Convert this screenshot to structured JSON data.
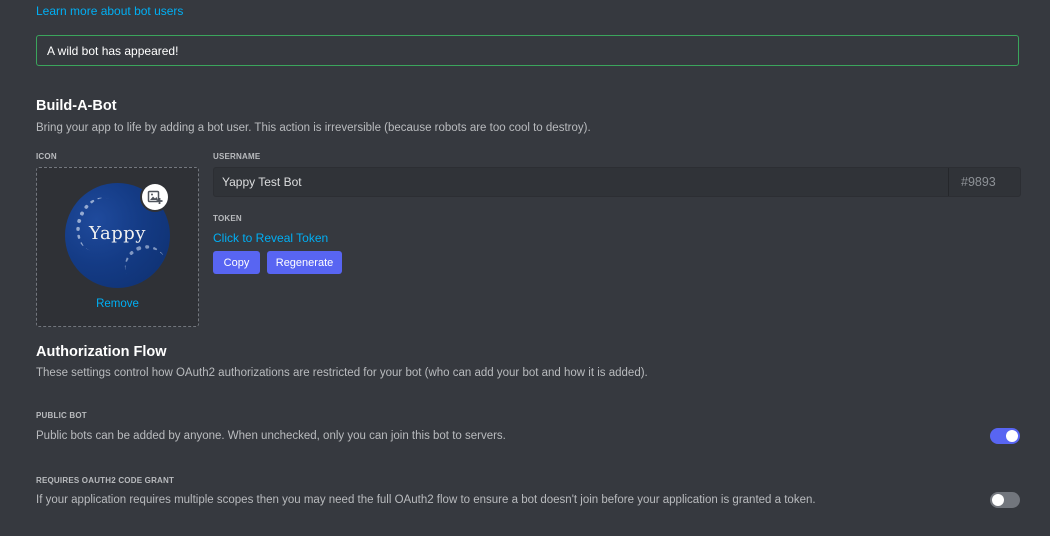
{
  "learn_more_link": "Learn more about bot users",
  "alert": {
    "text": "A wild bot has appeared!"
  },
  "build_a_bot": {
    "title": "Build-A-Bot",
    "description": "Bring your app to life by adding a bot user. This action is irreversible (because robots are too cool to destroy).",
    "icon_label": "ICON",
    "avatar_text": "Yappy",
    "remove_label": "Remove",
    "username_label": "USERNAME",
    "username_value": "Yappy Test Bot",
    "discriminator": "#9893",
    "token_label": "TOKEN",
    "reveal_token": "Click to Reveal Token",
    "copy_button": "Copy",
    "regenerate_button": "Regenerate"
  },
  "authorization_flow": {
    "title": "Authorization Flow",
    "description": "These settings control how OAuth2 authorizations are restricted for your bot (who can add your bot and how it is added).",
    "public_bot": {
      "label": "PUBLIC BOT",
      "description": "Public bots can be added by anyone. When unchecked, only you can join this bot to servers.",
      "enabled": true
    },
    "oauth2_grant": {
      "label": "REQUIRES OAUTH2 CODE GRANT",
      "description": "If your application requires multiple scopes then you may need the full OAuth2 flow to ensure a bot doesn't join before your application is granted a token.",
      "enabled": false
    }
  },
  "colors": {
    "background": "#36393f",
    "accent": "#5865f2",
    "link": "#00aff4",
    "success_border": "#3ba55c"
  }
}
